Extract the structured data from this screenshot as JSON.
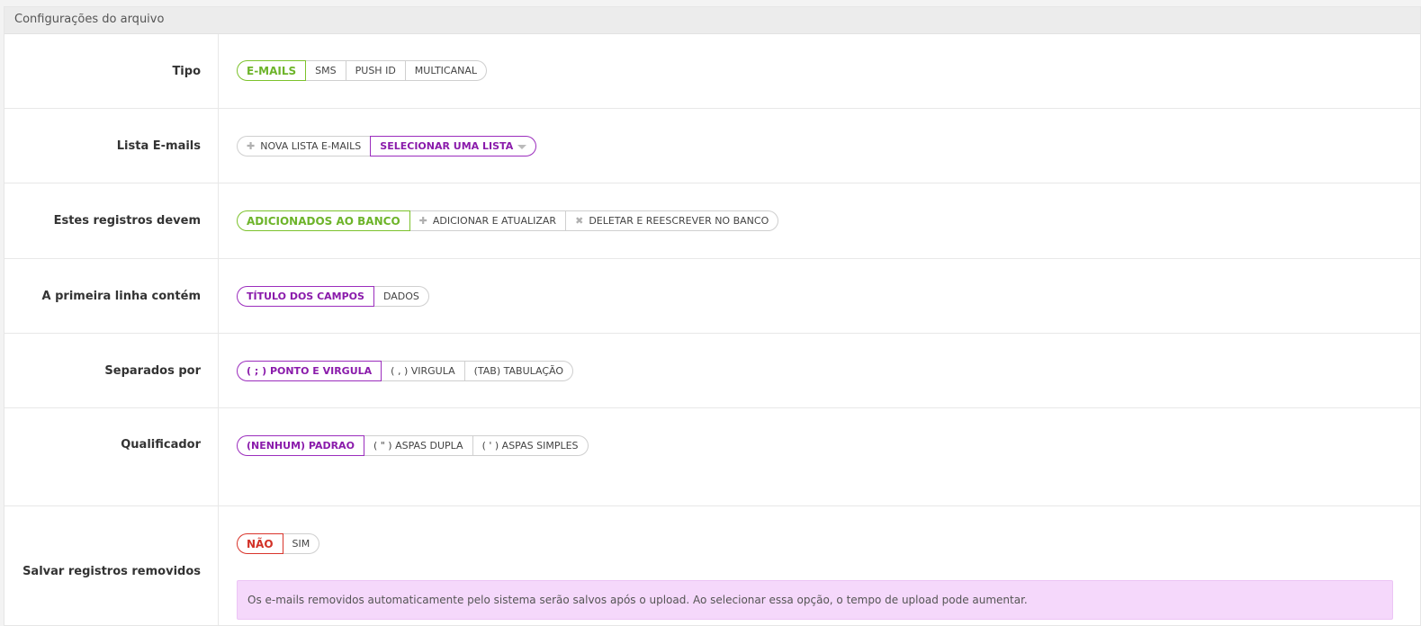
{
  "panel": {
    "title": "Configurações do arquivo"
  },
  "rows": {
    "tipo": {
      "label": "Tipo",
      "options": [
        "E-MAILS",
        "SMS",
        "PUSH ID",
        "MULTICANAL"
      ]
    },
    "lista": {
      "label": "Lista E-mails",
      "new_list": "NOVA LISTA E-MAILS",
      "select_list": "SELECIONAR UMA LISTA"
    },
    "registros": {
      "label": "Estes registros devem",
      "options": [
        "ADICIONADOS AO BANCO",
        "ADICIONAR E ATUALIZAR",
        "DELETAR E REESCREVER NO BANCO"
      ]
    },
    "primeira_linha": {
      "label": "A primeira linha contém",
      "options": [
        "TÍTULO DOS CAMPOS",
        "DADOS"
      ]
    },
    "separados": {
      "label": "Separados por",
      "options": [
        "( ; ) PONTO E VIRGULA",
        "( , ) VIRGULA",
        "(TAB) TABULAÇÃO"
      ]
    },
    "qualificador": {
      "label": "Qualificador",
      "options": [
        "(NENHUM) PADRAO",
        "( \" ) ASPAS DUPLA",
        "( ' ) ASPAS SIMPLES"
      ]
    },
    "salvar": {
      "label": "Salvar registros removidos",
      "options": [
        "NÃO",
        "SIM"
      ],
      "info": "Os e-mails removidos automaticamente pelo sistema serão salvos após o upload. Ao selecionar essa opção, o tempo de upload pode aumentar."
    }
  },
  "icons": {
    "plus": "plus-icon",
    "cross": "cross-icon",
    "caret": "caret-down-icon"
  },
  "colors": {
    "green": "#7cc22c",
    "purple": "#9b2dbd",
    "red": "#d9342b",
    "info_bg": "#f5d8fb"
  }
}
